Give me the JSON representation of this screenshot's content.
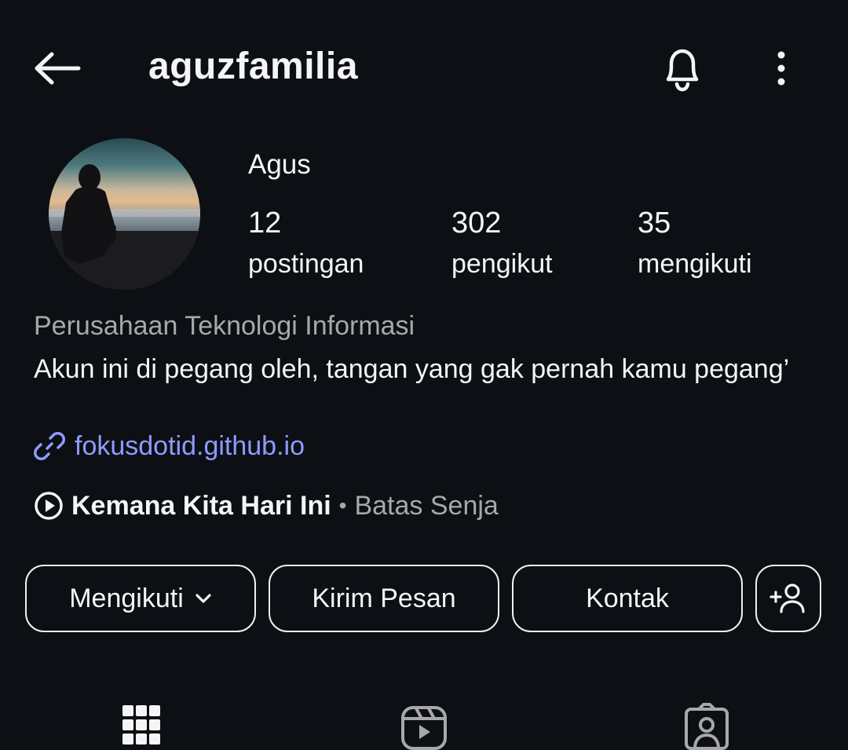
{
  "header": {
    "username": "aguzfamilia",
    "back_icon": "arrow-left-icon",
    "bell_icon": "bell-icon",
    "more_icon": "more-vertical-icon"
  },
  "profile": {
    "display_name": "Agus",
    "avatar": "profile-photo-silhouette-at-beach-sunset",
    "stats": {
      "posts": {
        "count": "12",
        "label": "postingan"
      },
      "followers": {
        "count": "302",
        "label": "pengikut"
      },
      "following": {
        "count": "35",
        "label": "mengikuti"
      }
    },
    "category": "Perusahaan Teknologi Informasi",
    "bio": "Akun ini di pegang oleh, tangan yang gak pernah kamu pegang’",
    "link": {
      "icon": "link-icon",
      "text": "fokusdotid.github.io"
    },
    "music": {
      "icon": "play-circle-icon",
      "song": "Kemana Kita Hari Ini",
      "separator": "•",
      "artist": "Batas Senja"
    }
  },
  "actions": {
    "follow_label": "Mengikuti",
    "message_label": "Kirim Pesan",
    "contact_label": "Kontak",
    "add_user_icon": "add-user-icon"
  },
  "tabs": [
    "grid-icon",
    "reels-icon",
    "tagged-icon"
  ],
  "colors": {
    "background": "#0c0f14",
    "text": "#f5f5f5",
    "secondary_text": "#a8a8a8",
    "link": "#8e9bff"
  }
}
